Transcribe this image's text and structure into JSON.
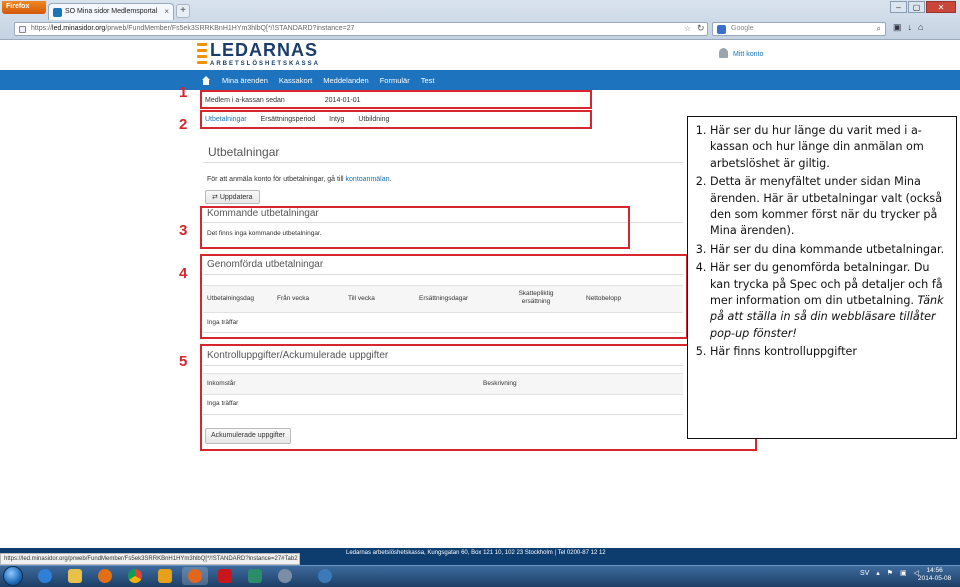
{
  "browser": {
    "app_button": "Firefox",
    "tab_title": "SO Mina sidor Medlemsportal",
    "new_tab": "+",
    "url_prefix": "https://",
    "url_domain": "led.minasidor.org",
    "url_rest": "/prweb/FundMember/Fs5ek3SRRKBnH1HYm3hlbQ[*/!STANDARD?instance=27",
    "search_engine": "Google",
    "window_controls": [
      "–",
      "▢",
      "✕"
    ]
  },
  "header": {
    "logo_title": "LEDARNAS",
    "logo_subtitle": "ARBETSLÖSHETSKASSA",
    "account_link": "Mitt konto"
  },
  "nav": {
    "items": [
      "Mina ärenden",
      "Kassakort",
      "Meddelanden",
      "Formulär",
      "Test"
    ]
  },
  "member_info": {
    "label": "Medlem i a-kassan sedan",
    "value": "2014-01-01"
  },
  "tabs": [
    "Utbetalningar",
    "Ersättningsperiod",
    "Intyg",
    "Utbildning"
  ],
  "page": {
    "heading": "Utbetalningar",
    "intro_text": "För att anmäla konto för utbetalningar, gå till ",
    "intro_link": "kontoanmälan",
    "intro_end": ".",
    "refresh_button": "Uppdatera"
  },
  "upcoming": {
    "title": "Kommande utbetalningar",
    "empty_text": "Det finns inga kommande utbetalningar."
  },
  "completed": {
    "title": "Genomförda utbetalningar",
    "columns": [
      "Utbetalningsdag",
      "Från vecka",
      "Till vecka",
      "Ersättningsdagar",
      "Skattepliktig ersättning",
      "Nettobelopp"
    ],
    "empty_text": "Inga träffar"
  },
  "control": {
    "title": "Kontrolluppgifter/Ackumulerade uppgifter",
    "columns": [
      "Inkomstår",
      "Beskrivning"
    ],
    "empty_text": "Inga träffar",
    "button": "Ackumulerade uppgifter"
  },
  "annotations": [
    "1",
    "2",
    "3",
    "4",
    "5"
  ],
  "callout": {
    "items": [
      "Här ser du hur länge du varit med i a-kassan och hur länge din anmälan om arbetslöshet är giltig.",
      "Detta är menyfältet under sidan Mina ärenden. Här är utbetalningar valt (också den som kommer först när du trycker på Mina ärenden).",
      "Här ser du dina kommande utbetalningar.",
      "Här ser du genomförda betalningar. Du kan trycka på Spec och på detaljer och få mer information om din utbetalning.",
      "Här finns kontrolluppgifter"
    ],
    "item4_italic": "Tänk på att ställa in så din webbläsare tillåter pop-up fönster!"
  },
  "footer": {
    "text": ", Kungsgatan 60, Box 121 10, 102 23 Stockholm | Tel 0200-87 12 12",
    "org": "Ledarnas arbetslöshetskassa"
  },
  "status_url": "https://led.minasidor.org/prweb/FundMember/Fs5ek3SRRKBnH1HYm3hlbQ[*/!STANDARD?instance=27#Tab2",
  "taskbar": {
    "language": "SV",
    "time": "14:56",
    "date": "2014-05-08"
  },
  "colors": {
    "nav_blue": "#1e73be",
    "brand_navy": "#1a3d6b",
    "brand_orange": "#f39200",
    "annotation_red": "#d7262e",
    "link_blue": "#1b74b8"
  }
}
